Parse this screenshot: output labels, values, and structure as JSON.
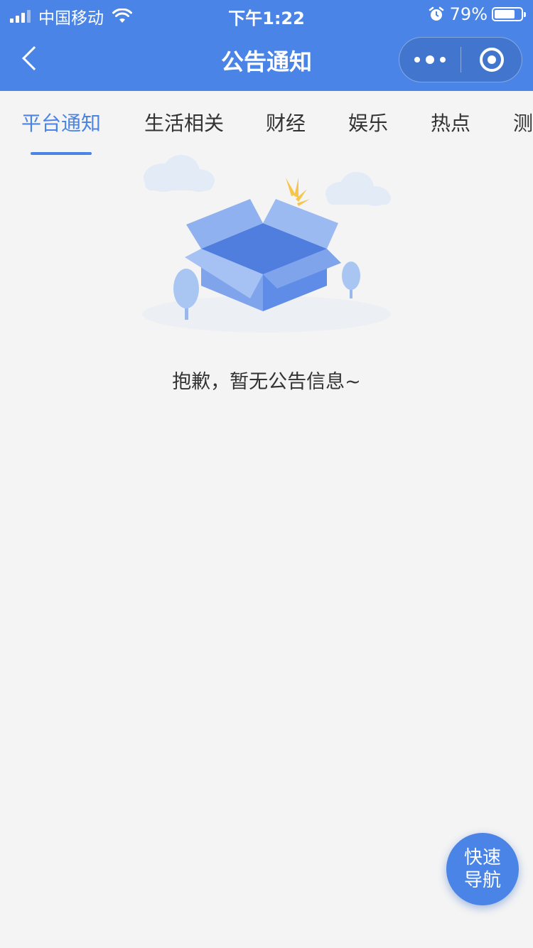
{
  "status_bar": {
    "carrier": "中国移动",
    "time": "下午1:22",
    "battery_text": "79%",
    "battery_level": 0.79
  },
  "nav": {
    "title": "公告通知",
    "back_icon": "chevron-left-icon",
    "more_icon": "more-dots-icon",
    "close_icon": "target-circle-icon"
  },
  "tabs": [
    {
      "label": "平台通知",
      "active": true
    },
    {
      "label": "生活相关",
      "active": false
    },
    {
      "label": "财经",
      "active": false
    },
    {
      "label": "娱乐",
      "active": false
    },
    {
      "label": "热点",
      "active": false
    },
    {
      "label": "测",
      "active": false
    }
  ],
  "empty_state": {
    "message": "抱歉，暂无公告信息~",
    "illustration": "empty-box-icon"
  },
  "fab": {
    "line1": "快速",
    "line2": "导航"
  },
  "colors": {
    "primary": "#4a84e6",
    "background": "#f4f4f4",
    "text": "#333333"
  }
}
